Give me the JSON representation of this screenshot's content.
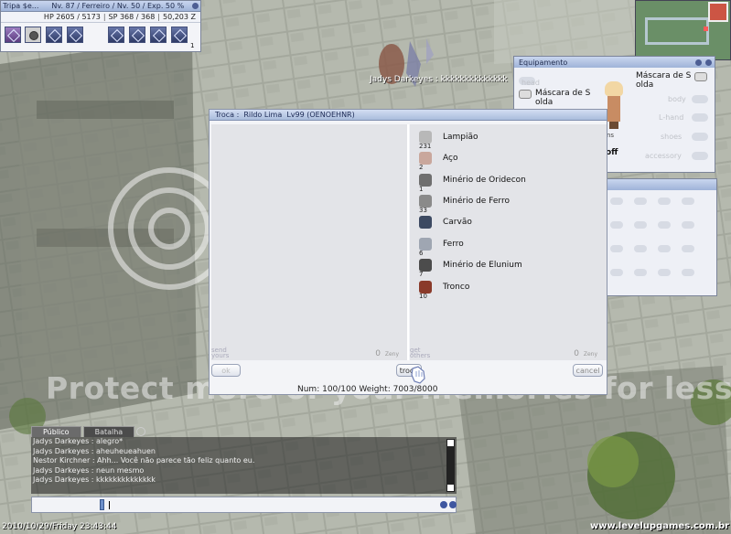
{
  "status": {
    "name": "Tripa $e...",
    "level_info": "Nv. 87 / Ferreiro / Nv. 50 / Exp. 50 %",
    "hp": "HP  2605 / 5173",
    "sp": "SP  368 / 368",
    "zeny": "50,203 Z",
    "hotkey_count": "1"
  },
  "equipment": {
    "title": "Equipamento",
    "left_item": "Máscara de S\nolda",
    "right_item": "Máscara de S\nolda",
    "slots": [
      "head",
      "body",
      "L-hand",
      "shoes",
      "accessory"
    ],
    "char_label": "ltens",
    "off_label": "off"
  },
  "overhead_name": "Jadys Darkeyes : kkkkkkkkkkkkkk",
  "trade": {
    "title": "Troca :  Rildo Lima  Lv99 (OENOEHNR)",
    "items": [
      {
        "qty": "231",
        "name": "Lampião",
        "color": "#b8b8b8"
      },
      {
        "qty": "2",
        "name": "Aço",
        "color": "#c9a79c"
      },
      {
        "qty": "1",
        "name": "Minério de Oridecon",
        "color": "#6f6f6f"
      },
      {
        "qty": "33",
        "name": "Minério de Ferro",
        "color": "#8a8a8a"
      },
      {
        "qty": "",
        "name": "Carvão",
        "color": "#3d4a62"
      },
      {
        "qty": "6",
        "name": "Ferro",
        "color": "#9fa6b2"
      },
      {
        "qty": "7",
        "name": "Minério de Elunium",
        "color": "#4c4c4c"
      },
      {
        "qty": "10",
        "name": "Tronco",
        "color": "#8a3a2a"
      }
    ],
    "left_foot": {
      "label": "send\nyours",
      "value": "0",
      "unit": "Zeny"
    },
    "right_foot": {
      "label": "get\nothers",
      "value": "0",
      "unit": "Zeny"
    },
    "btn_ok": "ok",
    "btn_troca": "troca",
    "btn_cancel": "cancel",
    "weight": "Num: 100/100  Weight: 7003/8000"
  },
  "chat": {
    "tabs": [
      "Público",
      "Batalha"
    ],
    "lines": [
      "Jadys Darkeyes : alegro*",
      "Jadys Darkeyes : aheuheueahuen",
      "Nestor Kirchner : Ahh... Você não parece tão feliz quanto eu.",
      "Jadys Darkeyes : neun  mesmo",
      "Jadys Darkeyes : kkkkkkkkkkkkkk"
    ],
    "input": ""
  },
  "datetime": "2010/10/29/Friday  23:43:44",
  "watermark": {
    "logo": "photobucket",
    "promo": "Protect more of your memories for less!"
  },
  "site_url": "www.levelupgames.com.br"
}
